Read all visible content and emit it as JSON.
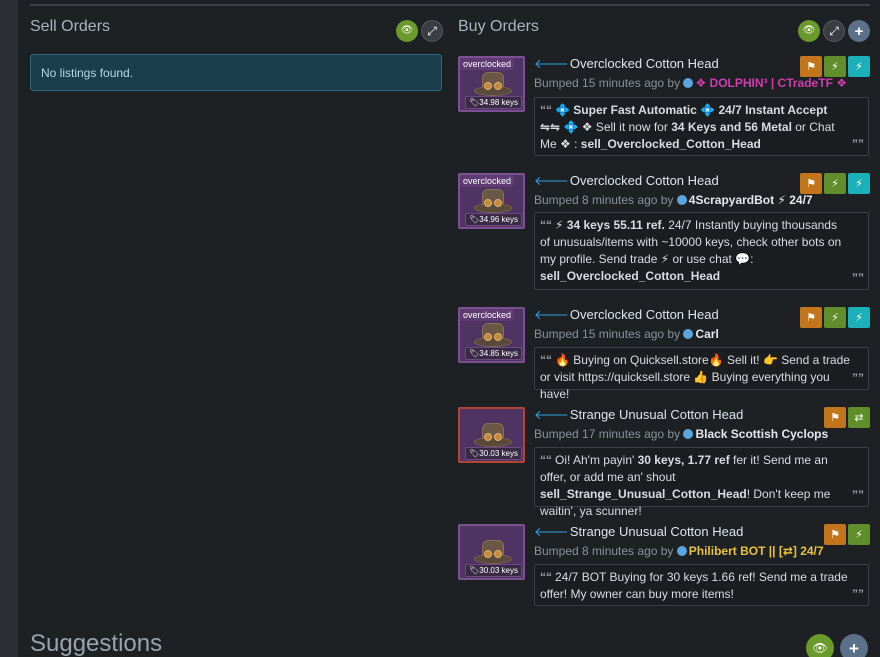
{
  "sell": {
    "title": "Sell Orders",
    "empty_text": "No listings found."
  },
  "buy": {
    "title": "Buy Orders"
  },
  "icons": {
    "eye": "👁",
    "expand": "⤢",
    "plus": "+",
    "flag": "⚑",
    "bolt": "⚡",
    "swap": "⇄",
    "arrow": "🡐",
    "quote_open": "““",
    "quote_close": "””"
  },
  "listings": [
    {
      "effect": "overclocked",
      "price": "34.98 keys",
      "name": "Overclocked Cotton Head",
      "bumped": "Bumped 15 minutes ago by",
      "user": "❖ DOLPHIN³ | CTradeTF ❖",
      "comment_html_parts": [
        "💠 ",
        "Super Fast Automatic",
        " 💠 ",
        "24/7 Instant Accept ⇋⇋",
        " 💠 ❖ Sell it now for ",
        "34 Keys and 56 Metal",
        " or Chat Me ❖ : ",
        "sell_Overclocked_Cotton_Head"
      ]
    },
    {
      "effect": "overclocked",
      "price": "34.96 keys",
      "name": "Overclocked Cotton Head",
      "bumped": "Bumped 8 minutes ago by",
      "user": "4ScrapyardBot ⚡ 24/7",
      "comment_parts": [
        "⚡ ",
        "34 keys 55.11 ref.",
        " 24/7 Instantly buying thousands of unusuals/items with ~10000 keys, check other bots on my profile. Send trade ⚡ or use chat 💬: ",
        "sell_Overclocked_Cotton_Head"
      ]
    },
    {
      "effect": "overclocked",
      "price": "34.85 keys",
      "name": "Overclocked Cotton Head",
      "bumped": "Bumped 15 minutes ago by",
      "user": "Carl",
      "comment": "🔥 Buying on Quicksell.store🔥 Sell it! 👉 Send a trade or visit https://quicksell.store 👍 Buying everything you have!"
    },
    {
      "price": "30.03 keys",
      "name": "Strange Unusual Cotton Head",
      "bumped": "Bumped 17 minutes ago by",
      "user": "Black Scottish Cyclops",
      "comment_parts": [
        "Oi! Ah'm payin' ",
        "30 keys, 1.77 ref",
        " fer it! Send me an offer, or add me an' shout ",
        "sell_Strange_Unusual_Cotton_Head",
        "! Don't keep me waitin', ya scunner!"
      ]
    },
    {
      "price": "30.03 keys",
      "name": "Strange Unusual Cotton Head",
      "bumped": "Bumped 8 minutes ago by",
      "user": "Philibert BOT || [⇄] 24/7",
      "comment": "24/7 BOT Buying for 30 keys 1.66 ref! Send me a trade offer! My owner can buy more items!"
    }
  ],
  "suggestions": {
    "title": "Suggestions"
  },
  "colors": {
    "accent_green": "#6a9a2c",
    "accent_orange": "#c3751c",
    "accent_teal": "#1cb0b8",
    "link_blue": "#2e9fe0"
  }
}
